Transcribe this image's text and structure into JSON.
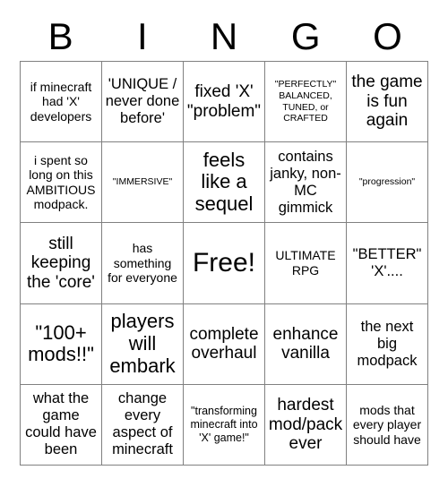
{
  "card": {
    "header_letters": [
      "B",
      "I",
      "N",
      "G",
      "O"
    ],
    "rows": [
      [
        "if minecraft had 'X' developers",
        "'UNIQUE / never done before'",
        "fixed 'X' \"problem\"",
        "\"PERFECTLY\" BALANCED, TUNED, or CRAFTED",
        "the game is fun again"
      ],
      [
        "i spent so long on this AMBITIOUS modpack.",
        "\"IMMERSIVE\"",
        "feels like a sequel",
        "contains janky, non-MC gimmick",
        "\"progression\""
      ],
      [
        "still keeping the 'core'",
        "has something for everyone",
        "Free!",
        "ULTIMATE RPG",
        "\"BETTER\" 'X'...."
      ],
      [
        "\"100+ mods!!\"",
        "players will embark",
        "complete overhaul",
        "enhance vanilla",
        "the next big modpack"
      ],
      [
        "what the game could have been",
        "change every aspect of minecraft",
        "\"transforming minecraft into 'X' game!\"",
        "hardest mod/pack ever",
        "mods that every player should have"
      ]
    ],
    "colors": {
      "background": "#ffffff",
      "text": "#000000",
      "grid_line": "#808080"
    }
  }
}
